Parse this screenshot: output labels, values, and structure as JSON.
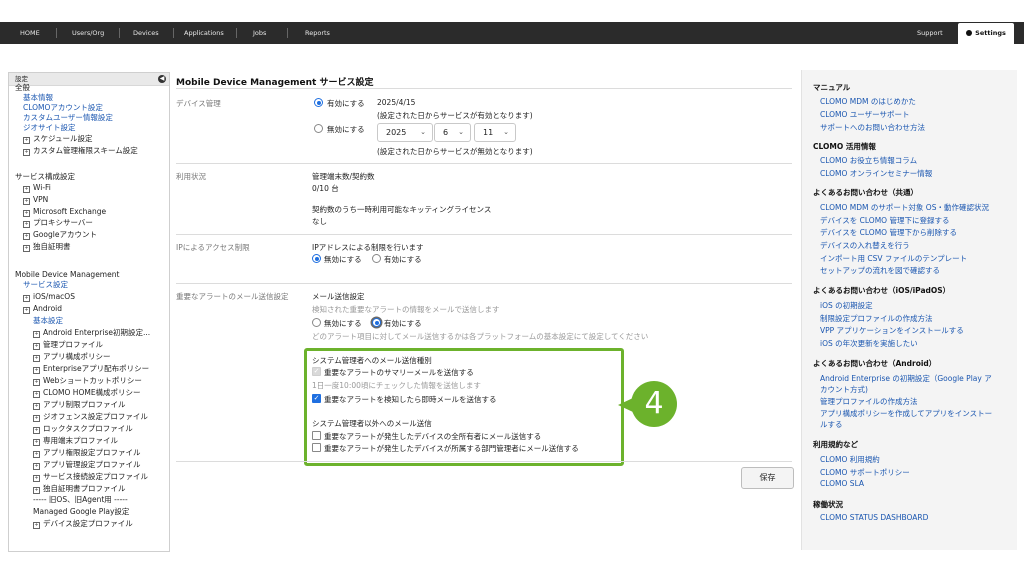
{
  "nav": {
    "items": [
      "HOME",
      "Users/Org",
      "Devices",
      "Applications",
      "Jobs",
      "Reports"
    ],
    "support": "Support",
    "settings": "Settings"
  },
  "sidebar": {
    "header": "設定",
    "items": [
      {
        "label": "全般",
        "kind": "plain",
        "plus": false
      },
      {
        "label": "基本情報",
        "kind": "link",
        "plus": false
      },
      {
        "label": "CLOMOアカウント設定",
        "kind": "link",
        "plus": false
      },
      {
        "label": "カスタムユーザー情報設定",
        "kind": "link",
        "plus": false
      },
      {
        "label": "ジオサイト設定",
        "kind": "link",
        "plus": false
      },
      {
        "label": "スケジュール設定",
        "kind": "plain",
        "plus": true
      },
      {
        "label": "カスタム管理権限スキーム設定",
        "kind": "plain",
        "plus": true
      },
      {
        "label": "サービス構成設定",
        "kind": "plain",
        "plus": false
      },
      {
        "label": "Wi-Fi",
        "kind": "plain",
        "plus": true
      },
      {
        "label": "VPN",
        "kind": "plain",
        "plus": true
      },
      {
        "label": "Microsoft Exchange",
        "kind": "plain",
        "plus": true
      },
      {
        "label": "プロキシサーバー",
        "kind": "plain",
        "plus": true
      },
      {
        "label": "Googleアカウント",
        "kind": "plain",
        "plus": true
      },
      {
        "label": "独自証明書",
        "kind": "plain",
        "plus": true
      },
      {
        "label": "Mobile Device Management",
        "kind": "plain",
        "plus": false
      },
      {
        "label": "サービス設定",
        "kind": "link",
        "plus": false
      },
      {
        "label": "iOS/macOS",
        "kind": "plain",
        "plus": true
      },
      {
        "label": "Android",
        "kind": "plain",
        "plus": true
      },
      {
        "label": "基本設定",
        "kind": "link",
        "plus": false
      },
      {
        "label": "Android Enterprise初期設定...",
        "kind": "plain",
        "plus": true
      },
      {
        "label": "管理プロファイル",
        "kind": "plain",
        "plus": true
      },
      {
        "label": "アプリ構成ポリシー",
        "kind": "plain",
        "plus": true
      },
      {
        "label": "Enterpriseアプリ配布ポリシー",
        "kind": "plain",
        "plus": true
      },
      {
        "label": "Webショートカットポリシー",
        "kind": "plain",
        "plus": true
      },
      {
        "label": "CLOMO HOME構成ポリシー",
        "kind": "plain",
        "plus": true
      },
      {
        "label": "アプリ制限プロファイル",
        "kind": "plain",
        "plus": true
      },
      {
        "label": "ジオフェンス設定プロファイル",
        "kind": "plain",
        "plus": true
      },
      {
        "label": "ロックタスクプロファイル",
        "kind": "plain",
        "plus": true
      },
      {
        "label": "専用端末プロファイル",
        "kind": "plain",
        "plus": true
      },
      {
        "label": "アプリ権限設定プロファイル",
        "kind": "plain",
        "plus": true
      },
      {
        "label": "アプリ管理設定プロファイル",
        "kind": "plain",
        "plus": true
      },
      {
        "label": "サービス接続設定プロファイル",
        "kind": "plain",
        "plus": true
      },
      {
        "label": "独自証明書プロファイル",
        "kind": "plain",
        "plus": true
      },
      {
        "label": "----- 旧OS、旧Agent用 -----",
        "kind": "plain",
        "plus": false
      },
      {
        "label": "Managed Google Play設定",
        "kind": "plain",
        "plus": false
      },
      {
        "label": "デバイス設定プロファイル",
        "kind": "plain",
        "plus": true
      }
    ]
  },
  "main": {
    "title": "Mobile Device Management サービス設定",
    "device_mgmt": {
      "label": "デバイス管理",
      "enable": "有効にする",
      "enable_date": "2025/4/15",
      "enable_note": "(設定された日からサービスが有効となります)",
      "disable": "無効にする",
      "year": "2025",
      "month": "6",
      "day": "11",
      "disable_note": "(設定された日からサービスが無効となります)"
    },
    "usage": {
      "label": "利用状況",
      "count_label": "管理端末数/契約数",
      "count_value": "0/10 台",
      "kitting_label": "契約数のうち一時利用可能なキッティングライセンス",
      "kitting_value": "なし"
    },
    "ip": {
      "label": "IPによるアクセス制限",
      "title": "IPアドレスによる制限を行います",
      "disable": "無効にする",
      "enable": "有効にする"
    },
    "alert": {
      "label": "重要なアラートのメール送信設定",
      "title": "メール送信設定",
      "desc": "検知された重要なアラートの情報をメールで送信します",
      "disable": "無効にする",
      "enable": "有効にする",
      "note": "どのアラート項目に対してメール送信するかは各プラットフォームの基本設定にて設定してください",
      "admin_title": "システム管理者へのメール送信種別",
      "summary": "重要なアラートのサマリーメールを送信する",
      "summary_note": "1日一度10:00頃にチェックした情報を送信します",
      "instant": "重要なアラートを検知したら即時メールを送信する",
      "others_title": "システム管理者以外へのメール送信",
      "owner": "重要なアラートが発生したデバイスの全所有者にメール送信する",
      "dept": "重要なアラートが発生したデバイスが所属する部門管理者にメール送信する"
    },
    "step": "4",
    "save": "保存"
  },
  "help": {
    "manual_title": "マニュアル",
    "manual_links": [
      "CLOMO MDM のはじめかた",
      "CLOMO ユーザーサポート",
      "サポートへのお問い合わせ方法"
    ],
    "info_title": "CLOMO 活用情報",
    "info_links": [
      "CLOMO お役立ち情報コラム",
      "CLOMO オンラインセミナー情報"
    ],
    "faq_title": "よくあるお問い合わせ（共通）",
    "faq_links": [
      "CLOMO MDM のサポート対象 OS・動作確認状況",
      "デバイスを CLOMO 管理下に登録する",
      "デバイスを CLOMO 管理下から削除する",
      "デバイスの入れ替えを行う",
      "インポート用 CSV ファイルのテンプレート",
      "セットアップの流れを図で確認する"
    ],
    "ios_title": "よくあるお問い合わせ（iOS/iPadOS）",
    "ios_links": [
      "iOS の初期設定",
      "制限設定プロファイルの作成方法",
      "VPP アプリケーションをインストールする",
      "iOS の年次更新を実施したい"
    ],
    "android_title": "よくあるお問い合わせ（Android）",
    "android_links": [
      "Android Enterprise の初期設定（Google Play ア",
      "カウント方式)",
      "管理プロファイルの作成方法",
      "アプリ構成ポリシーを作成してアプリをインストー",
      "ルする"
    ],
    "terms_title": "利用規約など",
    "terms_links": [
      "CLOMO 利用規約",
      "CLOMO サポートポリシー",
      "CLOMO SLA"
    ],
    "status_title": "稼働状況",
    "status_links": [
      "CLOMO STATUS DASHBOARD"
    ]
  }
}
